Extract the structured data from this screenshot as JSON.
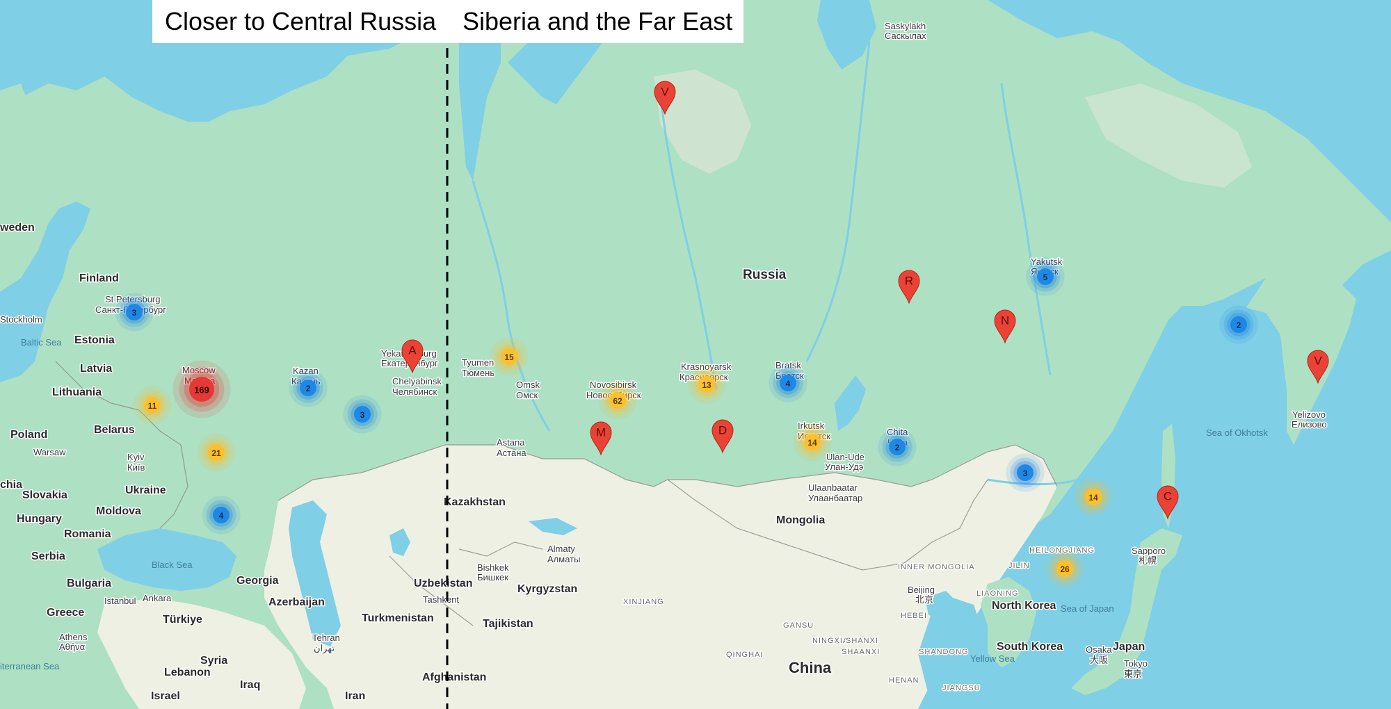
{
  "headers": {
    "left": "Closer to Central Russia",
    "right": "Siberia and the Far East"
  },
  "colors": {
    "water": "#7fcfe6",
    "land": "#aee0c3",
    "steppe": "#eef0e4",
    "cluster_blue": "#1e88e5",
    "cluster_yellow": "#fbc02d",
    "cluster_red": "#e53935",
    "pin": "#ea4335",
    "divider": "#000000"
  },
  "countries": [
    "Russia",
    "Kazakhstan",
    "Mongolia",
    "China",
    "Finland",
    "Estonia",
    "Latvia",
    "Lithuania",
    "Belarus",
    "Poland",
    "Ukraine",
    "Moldova",
    "Romania",
    "Hungary",
    "Slovakia",
    "Serbia",
    "Bulgaria",
    "Greece",
    "Türkiye",
    "Georgia",
    "Azerbaijan",
    "Turkmenistan",
    "Uzbekistan",
    "Kyrgyzstan",
    "Tajikistan",
    "Afghanistan",
    "Iran",
    "Iraq",
    "Syria",
    "Lebanon",
    "Israel",
    "North Korea",
    "South Korea",
    "Japan",
    "weden",
    "chia"
  ],
  "cities": [
    "St Petersburg",
    "Санкт-Петербург",
    "Moscow",
    "Москва",
    "Kazan",
    "Казань",
    "Yekaterinburg",
    "Екатеринбург",
    "Chelyabinsk",
    "Челябинск",
    "Tyumen",
    "Тюмень",
    "Omsk",
    "Омск",
    "Novosibirsk",
    "Новосибирск",
    "Krasnoyarsk",
    "Красноярск",
    "Bratsk",
    "Братск",
    "Irkutsk",
    "Иркутск",
    "Ulan-Ude",
    "Улан-Удэ",
    "Chita",
    "Чита",
    "Yakutsk",
    "Якутск",
    "Saskylakh",
    "Саскылах",
    "Yelizovo",
    "Елизово",
    "Astana",
    "Астана",
    "Almaty",
    "Алматы",
    "Bishkek",
    "Бишкек",
    "Tashkent",
    "Ulaanbaatar",
    "Улаанбаатар",
    "Beijing",
    "北京",
    "Sapporo",
    "札幌",
    "Osaka",
    "大阪",
    "Tokyo",
    "東京",
    "Stockholm",
    "Warsaw",
    "Kyiv",
    "Київ",
    "Istanbul",
    "Ankara",
    "Athens",
    "Αθήνα",
    "Tehran",
    "تهران"
  ],
  "seas": [
    "Baltic Sea",
    "Black Sea",
    "Sea of Okhotsk",
    "Sea of Japan",
    "Yellow Sea",
    "iterranean Sea"
  ],
  "regions": [
    "HEILONGJIANG",
    "JILIN",
    "LIAONING",
    "INNER MONGOLIA",
    "HEBEI",
    "XINJIANG",
    "GANSU",
    "NINGXIA",
    "SHANXI",
    "QINGHAI",
    "SHAANXI",
    "SHANDONG",
    "HENAN",
    "JIANGSU"
  ],
  "clusters": [
    {
      "count": "3",
      "color": "blue"
    },
    {
      "count": "169",
      "color": "red"
    },
    {
      "count": "11",
      "color": "yellow"
    },
    {
      "count": "21",
      "color": "yellow"
    },
    {
      "count": "2",
      "color": "blue"
    },
    {
      "count": "3",
      "color": "blue"
    },
    {
      "count": "4",
      "color": "blue"
    },
    {
      "count": "15",
      "color": "yellow"
    },
    {
      "count": "62",
      "color": "yellow"
    },
    {
      "count": "13",
      "color": "yellow"
    },
    {
      "count": "4",
      "color": "blue"
    },
    {
      "count": "14",
      "color": "yellow"
    },
    {
      "count": "2",
      "color": "blue"
    },
    {
      "count": "5",
      "color": "blue"
    },
    {
      "count": "2",
      "color": "blue"
    },
    {
      "count": "3",
      "color": "blue"
    },
    {
      "count": "14",
      "color": "yellow"
    },
    {
      "count": "26",
      "color": "yellow"
    }
  ],
  "pins": [
    "A",
    "V",
    "M",
    "D",
    "R",
    "N",
    "V",
    "C"
  ]
}
